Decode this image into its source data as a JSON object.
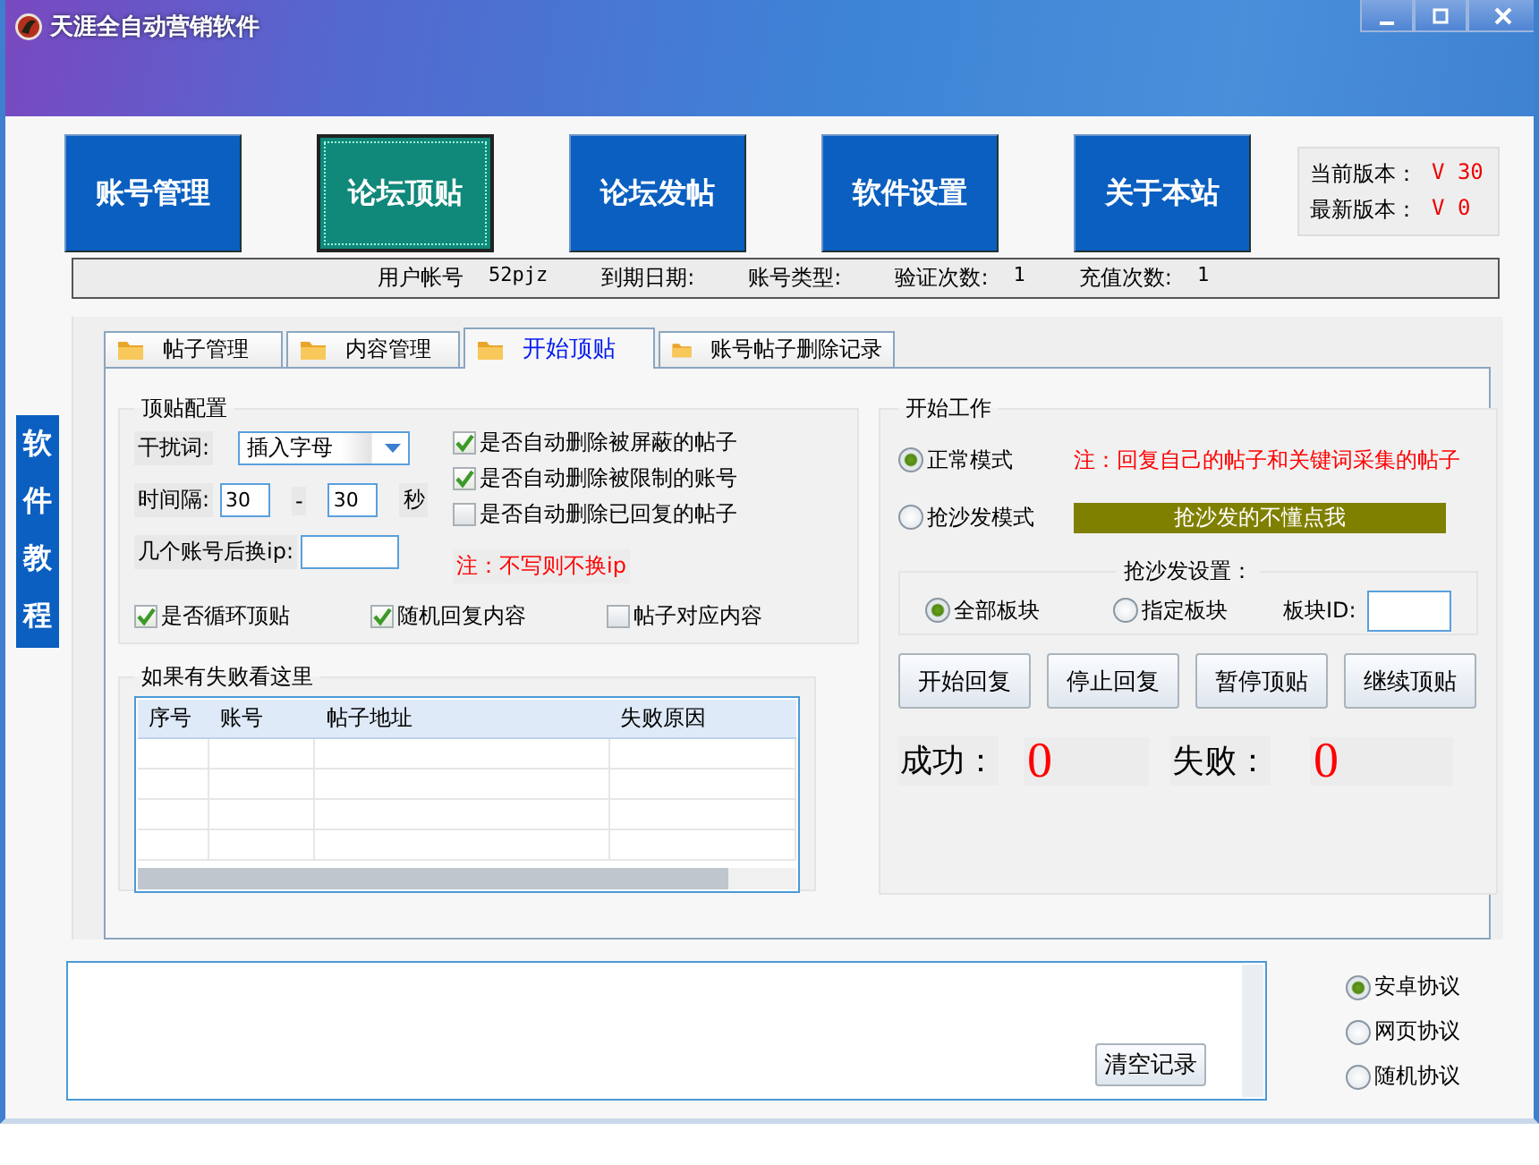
{
  "window": {
    "title": "天涯全自动营销软件"
  },
  "nav": [
    {
      "label": "账号管理",
      "selected": false
    },
    {
      "label": "论坛顶贴",
      "selected": true
    },
    {
      "label": "论坛发帖",
      "selected": false
    },
    {
      "label": "软件设置",
      "selected": false
    },
    {
      "label": "关于本站",
      "selected": false
    }
  ],
  "version": [
    {
      "label": "当前版本：",
      "value": "V 30"
    },
    {
      "label": "最新版本：",
      "value": "V 0"
    }
  ],
  "info_bar": [
    {
      "label": "用户帐号",
      "value": "52pjz"
    },
    {
      "label": "到期日期:"
    },
    {
      "label": "账号类型:"
    },
    {
      "label": "验证次数:",
      "value": "1"
    },
    {
      "label": "充值次数:",
      "value": "1"
    }
  ],
  "side_link": "软件教程",
  "tabs": [
    {
      "label": "帖子管理",
      "selected": false
    },
    {
      "label": "内容管理",
      "selected": false
    },
    {
      "label": "开始顶贴",
      "selected": true
    },
    {
      "label": "账号帖子删除记录",
      "selected": false
    }
  ],
  "config": {
    "title": "顶贴配置",
    "interference": {
      "label": "干扰词:",
      "value": "插入字母"
    },
    "interval": {
      "label": "时间隔:",
      "from": "30",
      "separator": "-",
      "to": "30",
      "unit": "秒"
    },
    "ip_switch": {
      "label": "几个账号后换ip:",
      "note": "注：不写则不换ip"
    },
    "options": [
      {
        "label": "是否自动删除被屏蔽的帖子",
        "checked": true
      },
      {
        "label": "是否自动删除被限制的账号",
        "checked": true
      },
      {
        "label": "是否自动删除已回复的帖子",
        "checked": false
      }
    ],
    "loop_options": [
      {
        "label": "是否循环顶贴",
        "checked": true
      },
      {
        "label": "随机回复内容",
        "checked": true
      },
      {
        "label": "帖子对应内容",
        "checked": false
      }
    ]
  },
  "failures": {
    "title": "如果有失败看这里",
    "columns": [
      "序号",
      "账号",
      "帖子地址",
      "失败原因"
    ]
  },
  "work": {
    "title": "开始工作",
    "modes": [
      {
        "label": "正常模式",
        "selected": true
      },
      {
        "label": "抢沙发模式",
        "selected": false
      }
    ],
    "note": "注：回复自己的帖子和关键词采集的帖子",
    "help_button": "抢沙发的不懂点我",
    "sofa": {
      "title": "抢沙发设置：",
      "scopes": [
        {
          "label": "全部板块",
          "selected": true
        },
        {
          "label": "指定板块",
          "selected": false
        }
      ],
      "board_id_label": "板块ID:"
    },
    "buttons": [
      "开始回复",
      "停止回复",
      "暂停顶贴",
      "继续顶贴"
    ],
    "stats": [
      {
        "label": "成功：",
        "value": "0"
      },
      {
        "label": "失败：",
        "value": "0"
      }
    ]
  },
  "log": {
    "clear_button": "清空记录"
  },
  "protocols": [
    {
      "label": "安卓协议",
      "selected": true
    },
    {
      "label": "网页协议",
      "selected": false
    },
    {
      "label": "随机协议",
      "selected": false
    }
  ]
}
